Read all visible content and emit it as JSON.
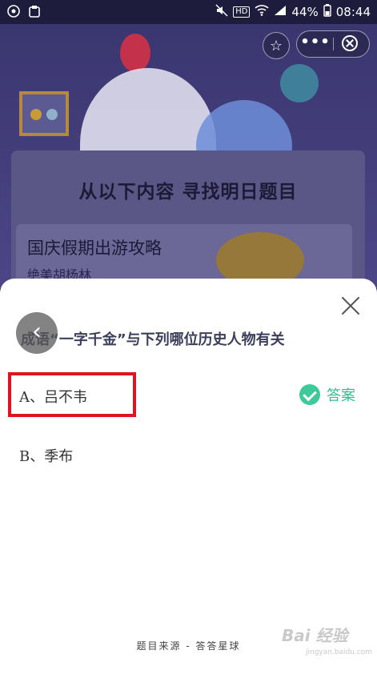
{
  "status_bar": {
    "battery": "44%",
    "time": "08:44",
    "hd": "HD"
  },
  "background": {
    "heading": "从以下内容 寻找明日题目",
    "item_title": "国庆假期出游攻略",
    "item_sub": "绝美胡杨林"
  },
  "capsule": {
    "more": "•••"
  },
  "sheet": {
    "question": "成语“一字千金”与下列哪位历史人物有关",
    "options": [
      {
        "label": "A、吕不韦"
      },
      {
        "label": "B、季布"
      }
    ],
    "answer_label": "答案",
    "footer": "题目来源 - 答答星球"
  },
  "watermark": {
    "text": "Bai 经验",
    "sub": "jingyan.baidu.com"
  },
  "colors": {
    "accent": "#3ec99a",
    "highlight": "#e0141e"
  },
  "icons": [
    "star-icon",
    "more-icon",
    "close-circle-icon",
    "close-icon",
    "back-arrow-icon",
    "check-icon"
  ]
}
